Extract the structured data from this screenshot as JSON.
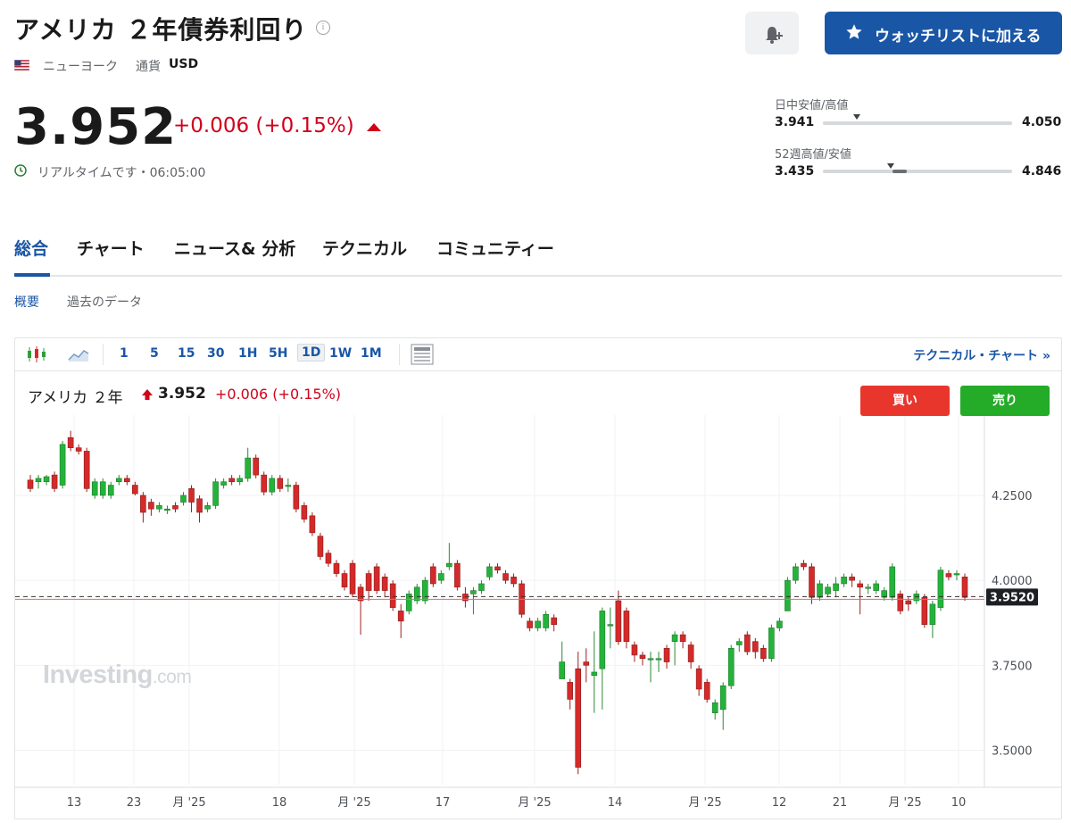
{
  "header": {
    "title": "アメリカ ２年債券利回り",
    "exchange": "ニューヨーク",
    "currency_label": "通貨",
    "currency": "USD",
    "watchlist_label": "ウォッチリストに加える"
  },
  "quote": {
    "price": "3.952",
    "change": "+0.006 (+0.15%)",
    "realtime": "リアルタイムです・06:05:00"
  },
  "ranges": {
    "day": {
      "label": "日中安値/高値",
      "low": "3.941",
      "high": "4.050",
      "position": 0.18
    },
    "week52": {
      "label": "52週高値/安値",
      "low": "3.435",
      "high": "4.846",
      "position": 0.36
    }
  },
  "tabs": [
    "総合",
    "チャート",
    "ニュース& 分析",
    "テクニカル",
    "コミュニティー"
  ],
  "subtabs": [
    "概要",
    "過去のデータ"
  ],
  "toolbar": {
    "timeframes": [
      "1",
      "5",
      "15",
      "30",
      "1H",
      "5H",
      "1D",
      "1W",
      "1M"
    ],
    "selected": "1D",
    "technical_chart": "テクニカル・チャート »"
  },
  "chart_legend": {
    "name": "アメリカ ２年",
    "price": "3.952",
    "change": "+0.006 (+0.15%)",
    "buy": "買い",
    "sell": "売り"
  },
  "watermark": {
    "brand": "Investing",
    "suffix": ".com"
  },
  "colors": {
    "up": "#24b33a",
    "down": "#d42a2a",
    "accent": "#1a56a6"
  },
  "chart_data": {
    "type": "candlestick",
    "y_ticks": [
      "4.2500",
      "4.0000",
      "3.7500",
      "3.5000"
    ],
    "ylim": [
      3.42,
      4.46
    ],
    "last_price_label": "3.9520",
    "x_ticks": [
      "13",
      "23",
      "月 '25",
      "18",
      "月 '25",
      "17",
      "月 '25",
      "14",
      "月 '25",
      "12",
      "21",
      "月 '25",
      "10"
    ],
    "candles": [
      [
        4.295,
        4.27,
        4.31,
        4.26
      ],
      [
        4.29,
        4.3,
        4.31,
        4.27
      ],
      [
        4.29,
        4.305,
        4.31,
        4.28
      ],
      [
        4.31,
        4.27,
        4.32,
        4.26
      ],
      [
        4.28,
        4.4,
        4.41,
        4.27
      ],
      [
        4.42,
        4.39,
        4.44,
        4.38
      ],
      [
        4.39,
        4.38,
        4.4,
        4.37
      ],
      [
        4.38,
        4.27,
        4.39,
        4.26
      ],
      [
        4.25,
        4.29,
        4.3,
        4.24
      ],
      [
        4.25,
        4.29,
        4.3,
        4.24
      ],
      [
        4.25,
        4.28,
        4.29,
        4.24
      ],
      [
        4.29,
        4.3,
        4.31,
        4.28
      ],
      [
        4.3,
        4.29,
        4.31,
        4.28
      ],
      [
        4.28,
        4.255,
        4.29,
        4.25
      ],
      [
        4.25,
        4.2,
        4.26,
        4.17
      ],
      [
        4.23,
        4.21,
        4.24,
        4.19
      ],
      [
        4.21,
        4.22,
        4.23,
        4.2
      ],
      [
        4.21,
        4.21,
        4.22,
        4.195
      ],
      [
        4.22,
        4.21,
        4.23,
        4.2
      ],
      [
        4.23,
        4.25,
        4.26,
        4.22
      ],
      [
        4.27,
        4.23,
        4.28,
        4.2
      ],
      [
        4.24,
        4.2,
        4.25,
        4.17
      ],
      [
        4.21,
        4.22,
        4.23,
        4.2
      ],
      [
        4.22,
        4.29,
        4.3,
        4.21
      ],
      [
        4.28,
        4.29,
        4.3,
        4.27
      ],
      [
        4.3,
        4.29,
        4.31,
        4.28
      ],
      [
        4.29,
        4.3,
        4.31,
        4.28
      ],
      [
        4.3,
        4.36,
        4.39,
        4.29
      ],
      [
        4.36,
        4.31,
        4.37,
        4.3
      ],
      [
        4.31,
        4.26,
        4.32,
        4.25
      ],
      [
        4.26,
        4.3,
        4.31,
        4.25
      ],
      [
        4.3,
        4.27,
        4.31,
        4.26
      ],
      [
        4.28,
        4.28,
        4.3,
        4.26
      ],
      [
        4.28,
        4.21,
        4.29,
        4.2
      ],
      [
        4.22,
        4.18,
        4.23,
        4.17
      ],
      [
        4.19,
        4.14,
        4.2,
        4.13
      ],
      [
        4.13,
        4.07,
        4.14,
        4.06
      ],
      [
        4.08,
        4.05,
        4.09,
        4.04
      ],
      [
        4.05,
        4.02,
        4.06,
        4.01
      ],
      [
        4.02,
        3.98,
        4.03,
        3.97
      ],
      [
        4.05,
        3.96,
        4.06,
        3.95
      ],
      [
        3.98,
        3.94,
        3.99,
        3.84
      ],
      [
        4.02,
        3.97,
        4.03,
        3.94
      ],
      [
        4.04,
        3.97,
        4.05,
        3.96
      ],
      [
        4.01,
        3.97,
        4.02,
        3.95
      ],
      [
        3.99,
        3.92,
        4.0,
        3.91
      ],
      [
        3.91,
        3.88,
        3.93,
        3.83
      ],
      [
        3.91,
        3.96,
        3.97,
        3.9
      ],
      [
        3.94,
        3.98,
        3.99,
        3.93
      ],
      [
        3.94,
        4.0,
        4.01,
        3.93
      ],
      [
        4.04,
        3.99,
        4.05,
        3.98
      ],
      [
        4.0,
        4.02,
        4.03,
        3.99
      ],
      [
        4.04,
        4.05,
        4.11,
        4.03
      ],
      [
        4.05,
        3.98,
        4.06,
        3.97
      ],
      [
        3.96,
        3.94,
        3.98,
        3.92
      ],
      [
        3.96,
        3.97,
        3.98,
        3.9
      ],
      [
        3.97,
        3.99,
        4.0,
        3.96
      ],
      [
        4.01,
        4.04,
        4.05,
        4.0
      ],
      [
        4.04,
        4.03,
        4.05,
        4.02
      ],
      [
        4.02,
        4.0,
        4.03,
        3.99
      ],
      [
        4.01,
        3.99,
        4.02,
        3.98
      ],
      [
        3.99,
        3.9,
        4.0,
        3.89
      ],
      [
        3.88,
        3.86,
        3.89,
        3.85
      ],
      [
        3.86,
        3.88,
        3.89,
        3.85
      ],
      [
        3.86,
        3.9,
        3.91,
        3.85
      ],
      [
        3.89,
        3.87,
        3.9,
        3.85
      ],
      [
        3.71,
        3.76,
        3.82,
        3.71
      ],
      [
        3.7,
        3.65,
        3.71,
        3.62
      ],
      [
        3.74,
        3.45,
        3.79,
        3.43
      ],
      [
        3.76,
        3.75,
        3.8,
        3.7
      ],
      [
        3.72,
        3.73,
        3.85,
        3.61
      ],
      [
        3.74,
        3.91,
        3.92,
        3.62
      ],
      [
        3.87,
        3.87,
        3.92,
        3.8
      ],
      [
        3.94,
        3.82,
        3.97,
        3.81
      ],
      [
        3.91,
        3.82,
        3.92,
        3.8
      ],
      [
        3.81,
        3.78,
        3.82,
        3.76
      ],
      [
        3.78,
        3.77,
        3.79,
        3.75
      ],
      [
        3.77,
        3.77,
        3.79,
        3.7
      ],
      [
        3.77,
        3.77,
        3.79,
        3.73
      ],
      [
        3.8,
        3.76,
        3.81,
        3.74
      ],
      [
        3.82,
        3.84,
        3.85,
        3.75
      ],
      [
        3.84,
        3.82,
        3.85,
        3.8
      ],
      [
        3.81,
        3.76,
        3.82,
        3.74
      ],
      [
        3.74,
        3.68,
        3.75,
        3.66
      ],
      [
        3.7,
        3.65,
        3.71,
        3.64
      ],
      [
        3.61,
        3.64,
        3.65,
        3.59
      ],
      [
        3.62,
        3.69,
        3.7,
        3.56
      ],
      [
        3.69,
        3.8,
        3.81,
        3.68
      ],
      [
        3.81,
        3.82,
        3.83,
        3.79
      ],
      [
        3.84,
        3.79,
        3.85,
        3.78
      ],
      [
        3.82,
        3.79,
        3.83,
        3.77
      ],
      [
        3.8,
        3.77,
        3.81,
        3.76
      ],
      [
        3.77,
        3.86,
        3.87,
        3.76
      ],
      [
        3.86,
        3.88,
        3.89,
        3.85
      ],
      [
        3.91,
        4.0,
        4.01,
        3.91
      ],
      [
        4.0,
        4.04,
        4.05,
        3.99
      ],
      [
        4.05,
        4.04,
        4.06,
        4.03
      ],
      [
        4.04,
        3.95,
        4.05,
        3.93
      ],
      [
        3.95,
        3.99,
        4.0,
        3.94
      ],
      [
        3.96,
        3.98,
        3.99,
        3.95
      ],
      [
        3.97,
        3.99,
        4.01,
        3.95
      ],
      [
        3.99,
        4.01,
        4.02,
        3.98
      ],
      [
        4.01,
        4.0,
        4.02,
        3.98
      ],
      [
        3.99,
        3.98,
        4.0,
        3.9
      ],
      [
        3.98,
        3.98,
        3.99,
        3.96
      ],
      [
        3.97,
        3.99,
        4.0,
        3.96
      ],
      [
        3.95,
        3.97,
        3.98,
        3.94
      ],
      [
        3.95,
        4.04,
        4.05,
        3.94
      ],
      [
        3.96,
        3.91,
        3.97,
        3.9
      ],
      [
        3.94,
        3.93,
        3.95,
        3.91
      ],
      [
        3.94,
        3.96,
        3.97,
        3.93
      ],
      [
        3.95,
        3.87,
        3.96,
        3.86
      ],
      [
        3.87,
        3.93,
        3.94,
        3.83
      ],
      [
        3.92,
        4.03,
        4.04,
        3.91
      ],
      [
        4.02,
        4.01,
        4.03,
        4.0
      ],
      [
        4.02,
        4.02,
        4.03,
        4.0
      ],
      [
        4.01,
        3.95,
        4.02,
        3.94
      ]
    ]
  }
}
